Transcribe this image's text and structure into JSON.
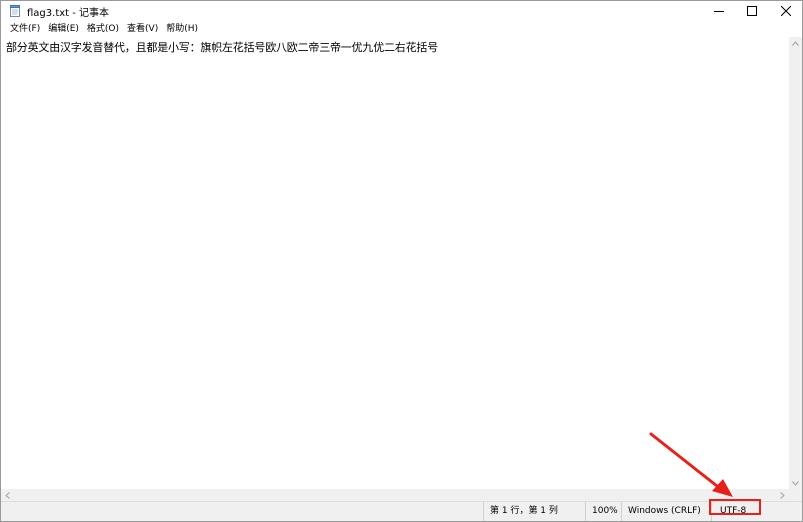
{
  "window": {
    "title": "flag3.txt - 记事本"
  },
  "menu": {
    "items": [
      "文件(F)",
      "编辑(E)",
      "格式(O)",
      "查看(V)",
      "帮助(H)"
    ]
  },
  "editor": {
    "content": "部分英文由汉字发音替代，且都是小写：旗帜左花括号欧八欧二帝三帝一优九优二右花括号"
  },
  "statusbar": {
    "position": "第 1 行，第 1 列",
    "zoom": "100%",
    "line_ending": "Windows (CRLF)",
    "encoding": "UTF-8"
  },
  "annotation": {
    "color": "#e8201a"
  },
  "icons": {
    "app": "notepad-icon",
    "minimize": "minimize-icon",
    "maximize": "maximize-icon",
    "close": "close-icon"
  }
}
